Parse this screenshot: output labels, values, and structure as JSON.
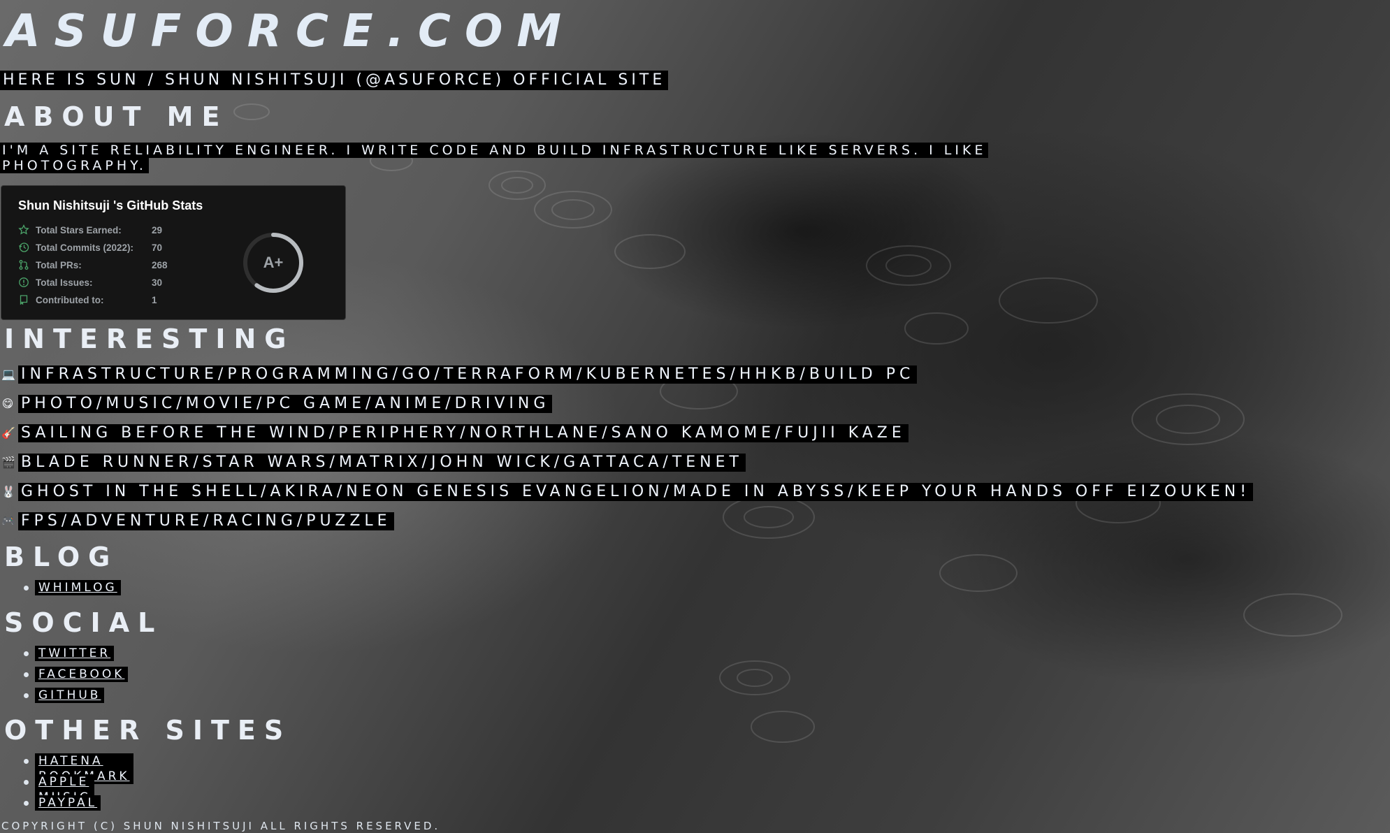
{
  "site": {
    "title": "Asuforce.com",
    "tagline": "Here is Sun / Shun Nishitsuji (@asuforce) official site"
  },
  "about": {
    "heading": "About me",
    "text_line1": "I'm a Site Reliability Engineer. I write code and build infrastructure like servers. I like",
    "text_line2": "photography."
  },
  "github_stats": {
    "title": "Shun Nishitsuji 's GitHub Stats",
    "rank": "A+",
    "rank_progress": 0.6,
    "rows": [
      {
        "icon": "star-icon",
        "label": "Total Stars Earned:",
        "value": "29"
      },
      {
        "icon": "history-icon",
        "label": "Total Commits (2022):",
        "value": "70"
      },
      {
        "icon": "pull-request-icon",
        "label": "Total PRs:",
        "value": "268"
      },
      {
        "icon": "issue-icon",
        "label": "Total Issues:",
        "value": "30"
      },
      {
        "icon": "repo-icon",
        "label": "Contributed to:",
        "value": "1"
      }
    ],
    "accent_color": "#4ca56a",
    "text_color": "#9ea3a8"
  },
  "interesting": {
    "heading": "Interesting",
    "items": [
      {
        "icon": "laptop-icon",
        "glyph": "💻",
        "text": "Infrastructure/Programming/Go/Terraform/Kubernetes/HHKB/Build PC"
      },
      {
        "icon": "smile-icon",
        "glyph": "😋",
        "text": "Photo/Music/Movie/PC Game/Anime/Driving"
      },
      {
        "icon": "guitar-icon",
        "glyph": "🎸",
        "text": "Sailing Before The Wind/Periphery/Northlane/Sano Kamome/Fujii Kaze"
      },
      {
        "icon": "clapper-icon",
        "glyph": "🎬",
        "text": "Blade Runner/Star Wars/Matrix/John Wick/Gattaca/Tenet"
      },
      {
        "icon": "rabbit-icon",
        "glyph": "🐰",
        "text": "Ghost in the Shell/AKIRA/Neon Genesis Evangelion/Made in Abyss/Keep Your Hands Off Eizouken!"
      },
      {
        "icon": "gamepad-icon",
        "glyph": "🎮",
        "text": "FPS/Adventure/Racing/Puzzle"
      }
    ]
  },
  "blog": {
    "heading": "Blog",
    "links": [
      "whimlog"
    ]
  },
  "social": {
    "heading": "Social",
    "links": [
      "Twitter",
      "Facebook",
      "GitHub"
    ]
  },
  "other_sites": {
    "heading": "Other Sites",
    "links": [
      "Hatena Bookmark",
      "Apple Music",
      "PayPal"
    ]
  },
  "footer": {
    "text": "Copyright (C) Shun Nishitsuji All Rights Reserved."
  }
}
